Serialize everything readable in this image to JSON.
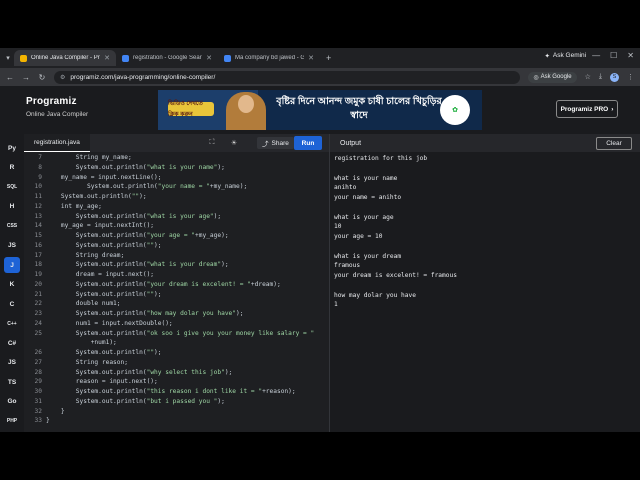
{
  "browser": {
    "tabs": [
      {
        "title": "Online Java Compiler - Programiz",
        "favicon_color": "#f4b400",
        "active": true
      },
      {
        "title": "registration - Google Search",
        "favicon_color": "#4285f4",
        "active": false
      },
      {
        "title": "Ma company bd jawed - Google",
        "favicon_color": "#4285f4",
        "active": false
      }
    ],
    "new_tab": "+",
    "ask_gemini": "Ask Gemini",
    "url": "programiz.com/java-programming/online-compiler/",
    "ask_google": "Ask Google",
    "profile_initial": "S"
  },
  "site": {
    "logo": "Programiz",
    "subtitle": "Online Java Compiler",
    "pro_button": "Programiz PRO",
    "ad": {
      "button": "ভিডিও দেখতে ক্লিক করুন",
      "headline": "বৃষ্টির দিনে আনন্দ জমুক চাষী চালের খিচুড়ির স্বাদে"
    }
  },
  "sidebar": {
    "items": [
      {
        "label": "Py"
      },
      {
        "label": "R"
      },
      {
        "label": "SQL"
      },
      {
        "label": "H"
      },
      {
        "label": "CSS"
      },
      {
        "label": "JS"
      },
      {
        "label": "J",
        "active": true
      },
      {
        "label": "K"
      },
      {
        "label": "C"
      },
      {
        "label": "C++"
      },
      {
        "label": "C#"
      },
      {
        "label": "JS"
      },
      {
        "label": "TS"
      },
      {
        "label": "Go"
      },
      {
        "label": "PHP"
      }
    ]
  },
  "editor": {
    "filename": "registration.java",
    "share_label": "Share",
    "run_label": "Run",
    "lines": [
      {
        "n": "7",
        "text": "        String my_name;"
      },
      {
        "n": "8",
        "text": "        System.out.println(\"what is your name\");"
      },
      {
        "n": "9",
        "text": "    my_name = input.nextLine();"
      },
      {
        "n": "10",
        "text": "           System.out.println(\"your name = \"+my_name);"
      },
      {
        "n": "11",
        "text": "    System.out.println(\"\");"
      },
      {
        "n": "12",
        "text": "    int my_age;"
      },
      {
        "n": "13",
        "text": "        System.out.println(\"what is your age\");"
      },
      {
        "n": "14",
        "text": "    my_age = input.nextInt();"
      },
      {
        "n": "15",
        "text": "        System.out.println(\"your age = \"+my_age);"
      },
      {
        "n": "16",
        "text": "        System.out.println(\"\");"
      },
      {
        "n": "17",
        "text": "        String dream;"
      },
      {
        "n": "18",
        "text": "        System.out.println(\"what is your dream\");"
      },
      {
        "n": "19",
        "text": "        dream = input.next();"
      },
      {
        "n": "20",
        "text": "        System.out.println(\"your dream is excelent! = \"+dream);"
      },
      {
        "n": "21",
        "text": "        System.out.println(\"\");"
      },
      {
        "n": "22",
        "text": "        double num1;"
      },
      {
        "n": "23",
        "text": "        System.out.println(\"how may dolar you have\");"
      },
      {
        "n": "24",
        "text": "        num1 = input.nextDouble();"
      },
      {
        "n": "25",
        "text": "        System.out.println(\"ok soo i give you your money like salary = \""
      },
      {
        "n": "",
        "text": "            +num1);"
      },
      {
        "n": "26",
        "text": "        System.out.println(\"\");"
      },
      {
        "n": "27",
        "text": "        String reason;"
      },
      {
        "n": "28",
        "text": "        System.out.println(\"why select this job\");"
      },
      {
        "n": "29",
        "text": "        reason = input.next();"
      },
      {
        "n": "30",
        "text": "        System.out.println(\"this reason i dont like it = \"+reason);"
      },
      {
        "n": "31",
        "text": "        System.out.println(\"but i passed you \");"
      },
      {
        "n": "32",
        "text": "    }"
      },
      {
        "n": "33",
        "text": "}"
      }
    ]
  },
  "output": {
    "title": "Output",
    "clear_label": "Clear",
    "lines": [
      "registration for this job",
      "",
      "what is your name",
      "anihto",
      "your name = anihto",
      "",
      "what is your age",
      "10",
      "your age = 10",
      "",
      "what is your dream",
      "framous",
      "your dream is excelent! = framous",
      "",
      "how may dolar you have",
      "1"
    ]
  }
}
